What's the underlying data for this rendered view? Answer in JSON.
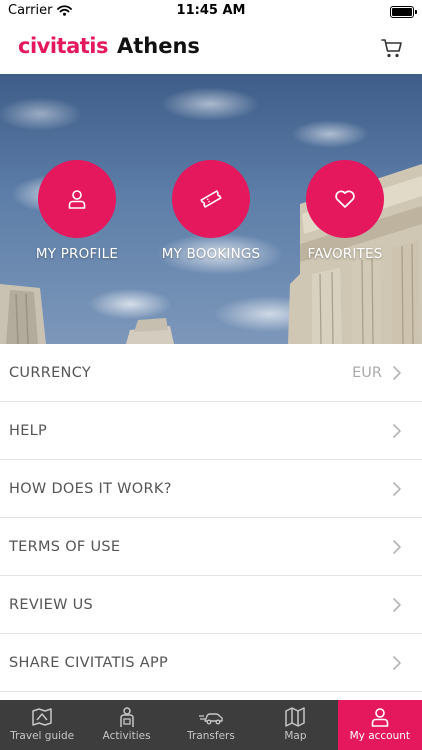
{
  "status_bar": {
    "carrier": "Carrier",
    "time": "11:45 AM"
  },
  "header": {
    "brand": "civitatis",
    "city": "Athens",
    "cart_icon": "shopping-cart-icon"
  },
  "hero": {
    "actions": [
      {
        "label": "MY PROFILE",
        "icon": "user-icon"
      },
      {
        "label": "MY BOOKINGS",
        "icon": "ticket-icon"
      },
      {
        "label": "FAVORITES",
        "icon": "heart-icon"
      }
    ]
  },
  "menu": {
    "items": [
      {
        "label": "CURRENCY",
        "value": "EUR"
      },
      {
        "label": "HELP",
        "value": ""
      },
      {
        "label": "HOW DOES IT WORK?",
        "value": ""
      },
      {
        "label": "TERMS OF USE",
        "value": ""
      },
      {
        "label": "REVIEW US",
        "value": ""
      },
      {
        "label": "SHARE CIVITATIS APP",
        "value": ""
      }
    ]
  },
  "tabs": [
    {
      "label": "Travel guide",
      "icon": "book-map-icon",
      "active": false
    },
    {
      "label": "Activities",
      "icon": "guide-person-icon",
      "active": false
    },
    {
      "label": "Transfers",
      "icon": "car-icon",
      "active": false
    },
    {
      "label": "Map",
      "icon": "map-icon",
      "active": false
    },
    {
      "label": "My account",
      "icon": "user-icon",
      "active": true
    }
  ],
  "colors": {
    "brand": "#e5175d",
    "tab_bar": "#3d3d3d"
  }
}
